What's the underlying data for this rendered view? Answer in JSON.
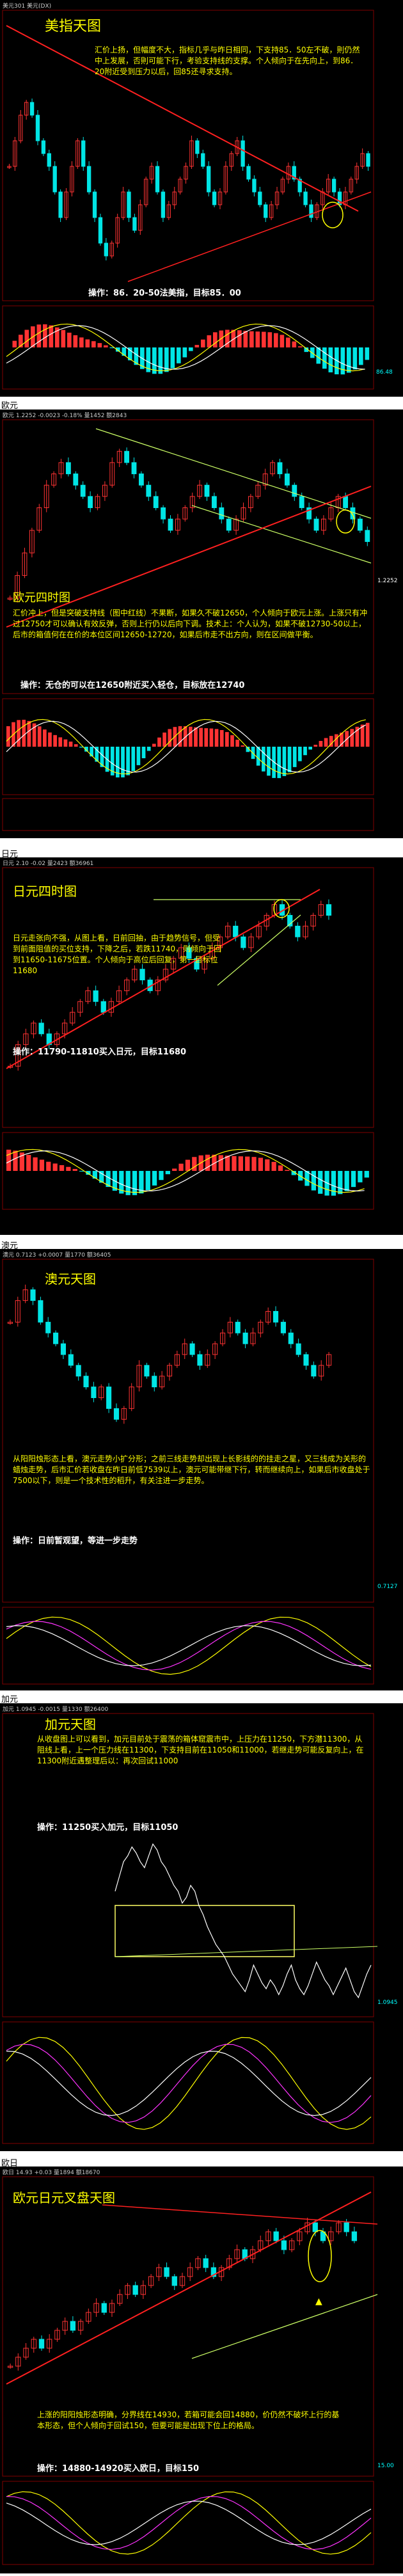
{
  "labels": {
    "eur": "欧元",
    "jpy": "日元",
    "aud": "澳元",
    "cad": "加元",
    "eurjpy": "欧日"
  },
  "colors": {
    "bg": "#000000",
    "title": "#ffff00",
    "text": "#ffffff",
    "up": "#ff3333",
    "down": "#00e5e5",
    "trend": "#ff2020",
    "channel": "#ccff66",
    "ma_yellow": "#ffff00",
    "ma_white": "#ffffff",
    "ma_magenta": "#ff33ff",
    "ma_green": "#33cc33",
    "box": "#ffff66"
  },
  "chart_data": [
    {
      "id": "usdx",
      "type": "candlestick",
      "title": "美指天图",
      "header": "美元301 美元(DX)",
      "analysis": "汇价上扬，但幅度不大，指标几乎与昨日相同，下支持85．50左不破，則仍然中上发展，否則可能下行，考验支持线的支撑。个人倾向于在先向上，到86．20附近受到压力以后，回85还寻求支持。",
      "operation": "操作：86．20-50法美指，目标85．00",
      "price_label": "86.48",
      "candles": [
        6,
        7,
        8,
        8.5,
        8,
        7,
        6.5,
        6,
        5,
        4,
        5,
        6,
        7,
        6,
        5,
        4,
        3,
        2.5,
        3,
        4,
        5,
        4,
        3.5,
        4.5,
        5.5,
        6,
        5,
        4,
        4.5,
        5,
        5.5,
        6,
        7,
        6.5,
        6,
        5,
        4.5,
        5,
        6,
        6.5,
        7,
        6,
        5.5,
        5,
        4.5,
        4,
        4.5,
        5,
        5.5,
        6,
        5.5,
        5,
        4.5,
        4,
        4.5,
        5,
        5.5,
        5,
        4.5,
        5,
        5.5,
        6,
        6.5,
        6
      ]
    },
    {
      "id": "eurusd",
      "type": "candlestick",
      "title": "欧元四时图",
      "header": "欧元 1.2252 -0.0023 -0.18% 量1452 额2843",
      "analysis": "汇价冲上，但是突破支持线（图中红线）不果断，如果久不破12650，个人倾向于欧元上涨。上涨只有冲过12750才可以确认有效反弹，否则上行仍以后向下调。技术上：个人认为，如果不破12730-50以上，后市的箱值何在在价的本位区间12650-12720，如果后市走不出方向，则在区间做平衡。",
      "operation": "操作：无仓的可以在12650附近买入轻仓，目标放在12740",
      "price_label": "1.2252",
      "candles": [
        2,
        3,
        4,
        5,
        6,
        7,
        7.5,
        8,
        7.5,
        7,
        6.5,
        6,
        6.5,
        7,
        8,
        8.5,
        8,
        7.5,
        7,
        6.5,
        6,
        5.5,
        5,
        5.5,
        6,
        6.5,
        7,
        6.5,
        6,
        5.5,
        5,
        5.5,
        6,
        6.5,
        7,
        7.5,
        8,
        7.5,
        7,
        6.5,
        6,
        5.5,
        5,
        5.5,
        6,
        6.5,
        6,
        5.5,
        5,
        4.5
      ]
    },
    {
      "id": "usdjpy",
      "type": "candlestick",
      "title": "日元四时图",
      "header": "日元 2.10 -0.02 量2423 额36961",
      "analysis": "日元走张向不强，从图上看，日前回抽，由于趋势信号，但受到前面阻值的买位支持，下降之后，若跌11740，则倾向于回到11650-11675位置。个人倾向于高位后回复，第一目标位11680",
      "operation": "操作：11790-11810买入日元，目标11680",
      "candles": [
        1,
        2,
        2.5,
        3,
        2.5,
        2,
        2.5,
        3,
        3.5,
        4,
        4.5,
        4,
        3.5,
        4,
        4.5,
        5,
        5.5,
        5,
        4.5,
        5,
        5.5,
        6,
        6.5,
        6,
        5.5,
        6,
        6.5,
        7,
        7.5,
        7,
        6.5,
        7,
        7.5,
        8,
        8.5,
        8,
        7.5,
        7,
        7.5,
        8,
        8.5,
        8
      ]
    },
    {
      "id": "audusd",
      "type": "candlestick",
      "title": "澳元天图",
      "header": "澳元 0.7123 +0.0007 量1770 额36405",
      "analysis": "从阳阳烛形态上看，澳元走势小扩分形；之前三线走势却出现上长影线的的挂走之星，又三线成为关形的蜡烛走势，后市汇价若收盘在昨日前低7539以上，澳元可能带继下行，转而继续向上，如果后市收盘处于7500以下，则是一个技术性的稻升，有关注进一步走势。",
      "operation": "操作：日前暂观望，等进一步走势",
      "price_label": "0.7127",
      "candles": [
        7,
        8,
        8.5,
        8,
        7,
        6.5,
        6,
        5.5,
        5,
        4.5,
        4,
        3.5,
        4,
        3,
        2.5,
        3,
        4,
        5,
        4.5,
        4,
        4.5,
        5,
        5.5,
        6,
        5.5,
        5,
        5.5,
        6,
        6.5,
        7,
        6.5,
        6,
        6.5,
        7,
        7.5,
        7,
        6.5,
        6,
        5.5,
        5,
        4.5,
        5,
        5.5
      ]
    },
    {
      "id": "usdcad",
      "type": "line",
      "title": "加元天图",
      "header": "加元 1.0945 -0.0015 量1330 额26400",
      "analysis": "从收盘图上可以看到，加元目前处于震荡的箱体窟震市中，上压力在11250，下方潜11300，从阻线上看，上一个压力线在11300，下支持目前在11050和11000，若继走势可能反复向上，在11300附近遇整理后以：再次回试11000",
      "operation": "操作：11250买入加元，目标11050",
      "price_label": "1.0945",
      "values": [
        7,
        7.5,
        8,
        8.2,
        8.5,
        8.3,
        8,
        7.8,
        8.2,
        8.6,
        8.4,
        8,
        7.8,
        7.5,
        7.2,
        7,
        6.6,
        6.8,
        7.2,
        7,
        6.5,
        6.2,
        5.8,
        5.5,
        5.2,
        5,
        4.8,
        4.5,
        4.2,
        4,
        3.8,
        3.6,
        4,
        4.5,
        4.2,
        3.9,
        3.7,
        4,
        3.8,
        3.5,
        3.8,
        4.2,
        4.5,
        4,
        3.7,
        3.5,
        3.8,
        4.2,
        4.6,
        4.3,
        4,
        3.8,
        3.5,
        3.8,
        4.1,
        4.4,
        4,
        3.6,
        3.4,
        3.8,
        4.2,
        4.5
      ]
    },
    {
      "id": "eurjpy",
      "type": "candlestick",
      "title": "欧元日元叉盘天图",
      "header": "欧日 14.93 +0.03 量1894 额18670",
      "analysis": "上涨的阳阳烛形态明确，分界线在14930，若箱可能会回14880，价仍然不破坏上行的基本形态，但个人倾向于回试150，但要可能是出现下位上的格局。",
      "operation": "操作：14880-14920买入欧日，目标150",
      "price_label": "15.00",
      "candles": [
        1,
        1.5,
        2,
        2.5,
        2,
        2.5,
        3,
        3.5,
        3,
        3.5,
        4,
        4.5,
        4,
        4.5,
        5,
        5.5,
        5,
        5.5,
        6,
        6.5,
        6,
        5.5,
        6,
        6.5,
        7,
        6.5,
        6,
        6.5,
        7,
        7.5,
        7,
        7.5,
        8,
        8.5,
        8,
        7.5,
        8,
        8.5,
        9,
        8.5,
        8,
        8.5,
        9,
        8.5,
        8
      ]
    }
  ]
}
